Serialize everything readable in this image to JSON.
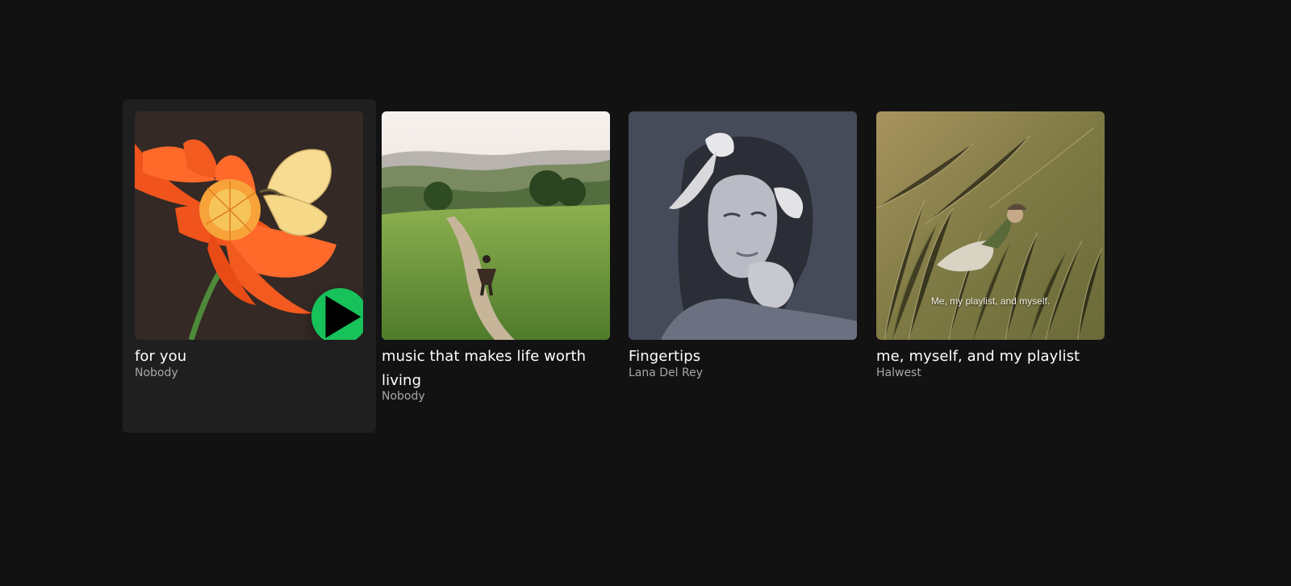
{
  "colors": {
    "background": "#121212",
    "card_hover": "#1f1f1f",
    "play_accent": "#17c25a",
    "title_text": "#ffffff",
    "subtitle_text": "#a7a7a7"
  },
  "cards": [
    {
      "title": "for you",
      "subtitle": "Nobody",
      "cover_icon": "orange-flower-butterfly-art",
      "hovered": true,
      "play_icon": "play-icon"
    },
    {
      "title": "music that makes life worth living",
      "subtitle": "Nobody",
      "cover_icon": "hillside-path-photo"
    },
    {
      "title": "Fingertips",
      "subtitle": "Lana Del Rey",
      "cover_icon": "black-and-white-portrait-photo"
    },
    {
      "title": "me, myself, and my playlist",
      "subtitle": "Halwest",
      "cover_icon": "person-lying-in-grass-photo",
      "cover_caption": "Me, my playlist, and myself."
    }
  ]
}
